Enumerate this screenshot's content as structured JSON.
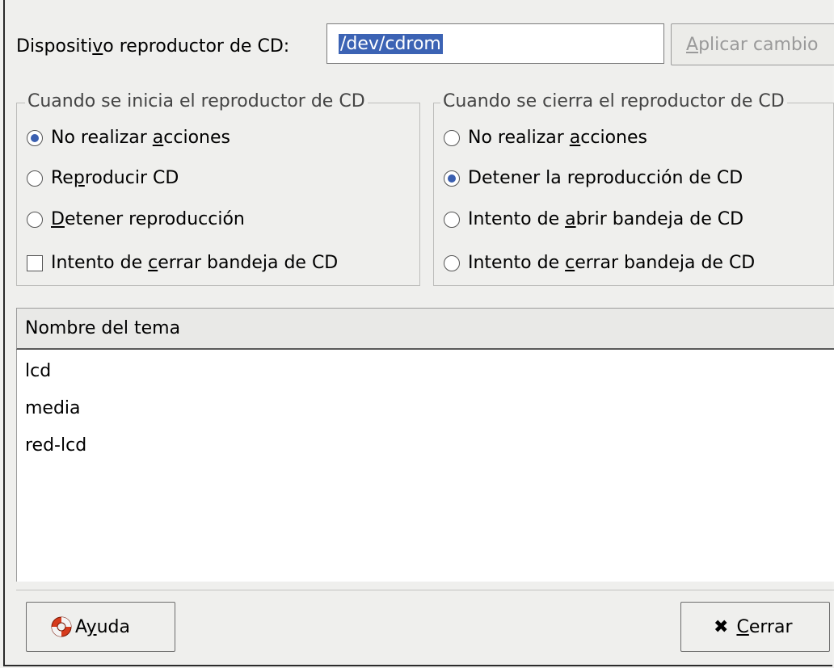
{
  "device": {
    "label_before": "Dispositi",
    "label_mnemonic": "v",
    "label_after": "o reproductor de CD:",
    "value": "/dev/cdrom",
    "apply_mnemonic": "A",
    "apply_rest": "plicar cambio"
  },
  "start_group": {
    "title": "Cuando se inicia el reproductor de CD",
    "options": [
      {
        "pre": "No realizar ",
        "mn": "a",
        "post": "cciones",
        "selected": true
      },
      {
        "pre": "Re",
        "mn": "p",
        "post": "roducir CD",
        "selected": false
      },
      {
        "pre": "",
        "mn": "D",
        "post": "etener reproducción",
        "selected": false
      }
    ],
    "checkbox": {
      "pre": "Intento de ",
      "mn": "c",
      "post": "errar bandeja de CD",
      "checked": false
    }
  },
  "close_group": {
    "title": "Cuando se cierra el reproductor de CD",
    "options": [
      {
        "pre": "No realizar ",
        "mn": "a",
        "post": "cciones",
        "selected": false
      },
      {
        "pre": "Detener la reproducción de CD",
        "mn": "",
        "post": "",
        "selected": true
      },
      {
        "pre": "Intento de ",
        "mn": "a",
        "post": "brir bandeja de CD",
        "selected": false
      },
      {
        "pre": "Intento de ",
        "mn": "c",
        "post": "errar bandeja de CD",
        "selected": false
      }
    ]
  },
  "themes": {
    "header": "Nombre del tema",
    "items": [
      "lcd",
      "media",
      "red-lcd"
    ]
  },
  "buttons": {
    "help_pre": "A",
    "help_mn": "y",
    "help_post": "uda",
    "close_mn": "C",
    "close_post": "errar",
    "close_icon": "close-x-icon",
    "help_icon": "lifebuoy-icon"
  },
  "colors": {
    "selection": "#3c63b4",
    "radio_dot": "#3a5fb0"
  }
}
